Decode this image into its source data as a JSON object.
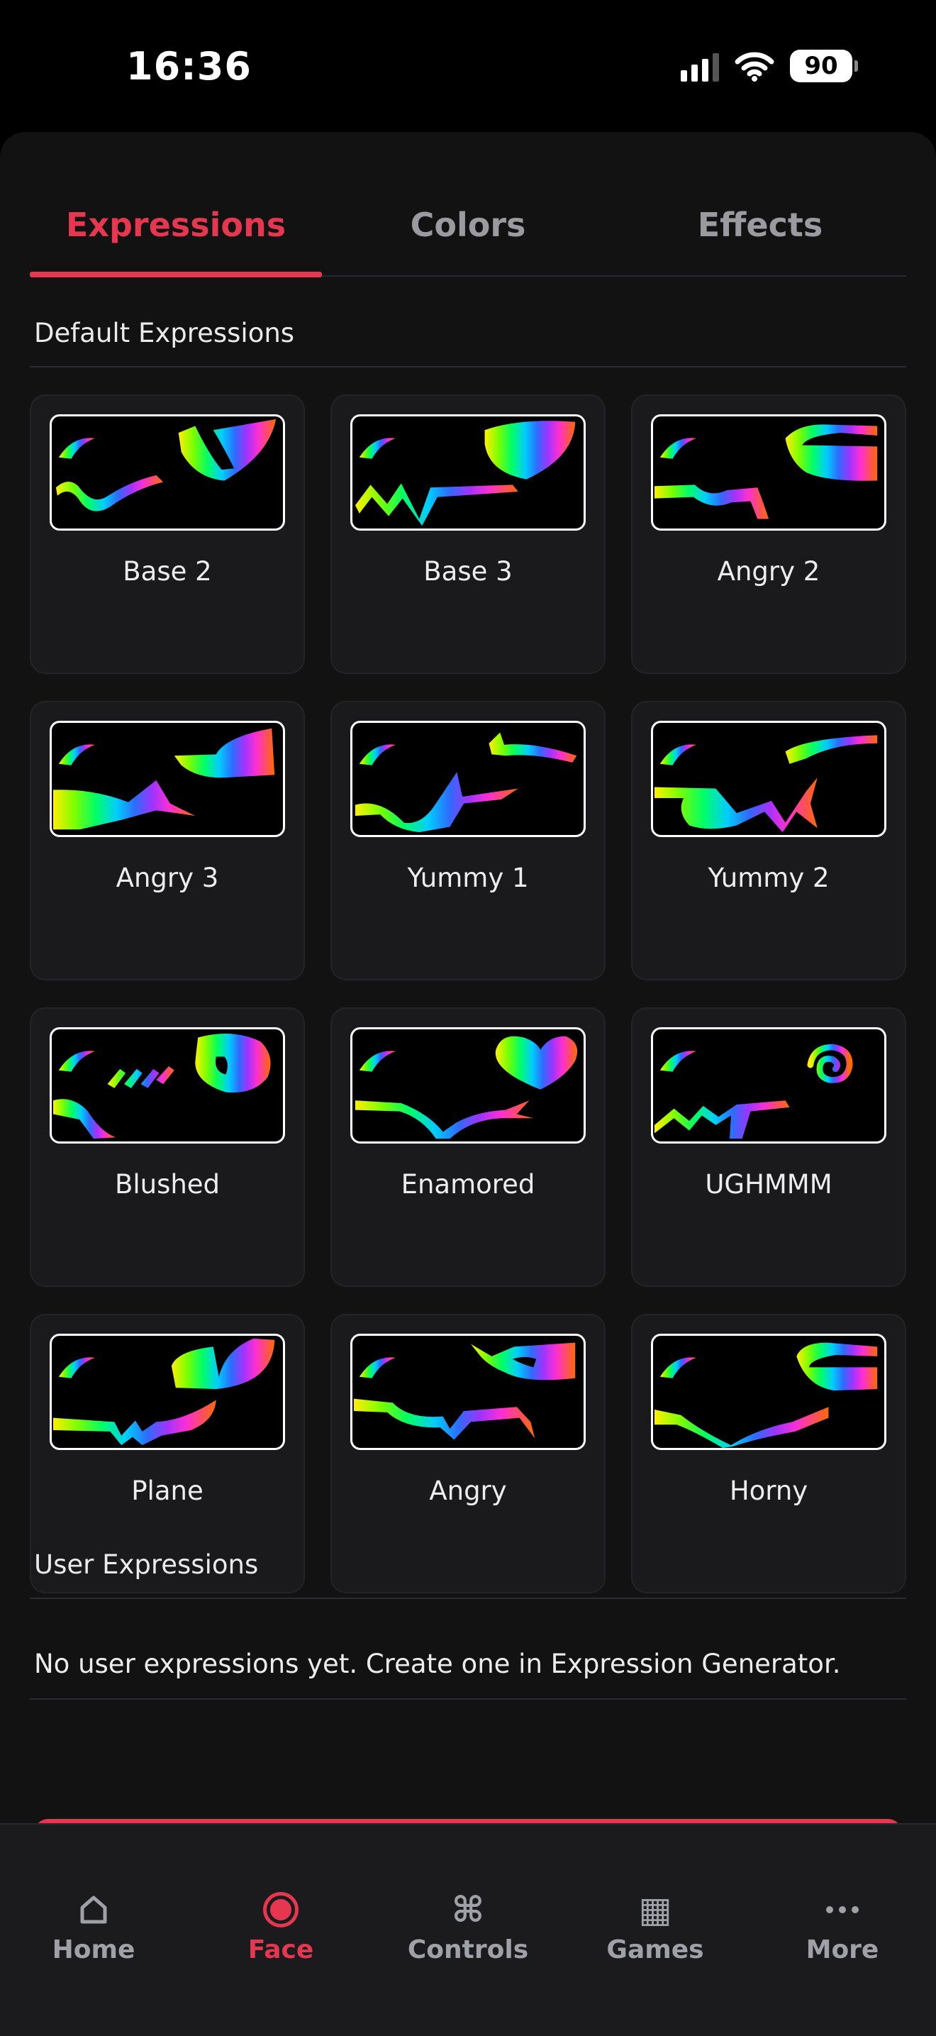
{
  "status": {
    "time": "16:36",
    "battery": "90"
  },
  "tabs": [
    {
      "label": "Expressions",
      "active": true
    },
    {
      "label": "Colors",
      "active": false
    },
    {
      "label": "Effects",
      "active": false
    }
  ],
  "default_section": {
    "title": "Default Expressions"
  },
  "expressions": [
    {
      "name": "Base 2"
    },
    {
      "name": "Base 3"
    },
    {
      "name": "Angry 2"
    },
    {
      "name": "Angry 3"
    },
    {
      "name": "Yummy 1"
    },
    {
      "name": "Yummy 2"
    },
    {
      "name": "Blushed"
    },
    {
      "name": "Enamored"
    },
    {
      "name": "UGHMMM"
    },
    {
      "name": "Plane"
    },
    {
      "name": "Angry"
    },
    {
      "name": "Horny"
    }
  ],
  "user_section": {
    "title": "User Expressions",
    "empty_text": "No user expressions yet. Create one in Expression Generator."
  },
  "nav": [
    {
      "label": "Home",
      "icon": "home-icon"
    },
    {
      "label": "Face",
      "icon": "record-icon",
      "active": true
    },
    {
      "label": "Controls",
      "icon": "command-icon"
    },
    {
      "label": "Games",
      "icon": "grid-icon"
    },
    {
      "label": "More",
      "icon": "more-icon"
    }
  ],
  "colors": {
    "accent": "#e5374f",
    "background": "#000000",
    "card": "#1a1a1c"
  }
}
